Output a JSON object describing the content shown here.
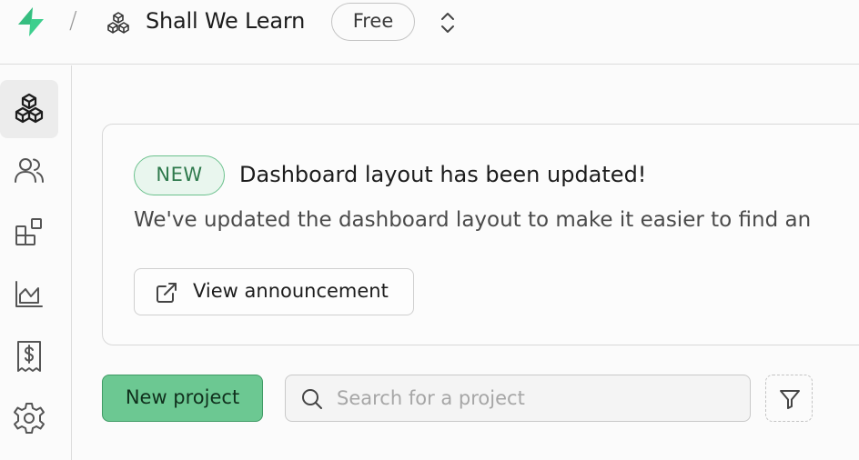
{
  "header": {
    "separator": "/",
    "org_name": "Shall We Learn",
    "plan": "Free"
  },
  "sidebar": {
    "items": [
      {
        "name": "projects",
        "icon": "cubes-icon",
        "active": true
      },
      {
        "name": "team",
        "icon": "users-icon",
        "active": false
      },
      {
        "name": "integrations",
        "icon": "blocks-icon",
        "active": false
      },
      {
        "name": "usage",
        "icon": "chart-icon",
        "active": false
      },
      {
        "name": "billing",
        "icon": "receipt-icon",
        "active": false
      },
      {
        "name": "settings",
        "icon": "gear-icon",
        "active": false
      }
    ]
  },
  "announcement": {
    "badge": "NEW",
    "title": "Dashboard layout has been updated!",
    "description": "We've updated the dashboard layout to make it easier to find an",
    "button_label": "View announcement"
  },
  "actions": {
    "new_project_label": "New project",
    "search_placeholder": "Search for a project"
  },
  "colors": {
    "brand_green": "#3ecf8e",
    "primary_button": "#6cc892",
    "new_badge_bg": "#e9f6ee",
    "new_badge_text": "#2f7a4d"
  }
}
